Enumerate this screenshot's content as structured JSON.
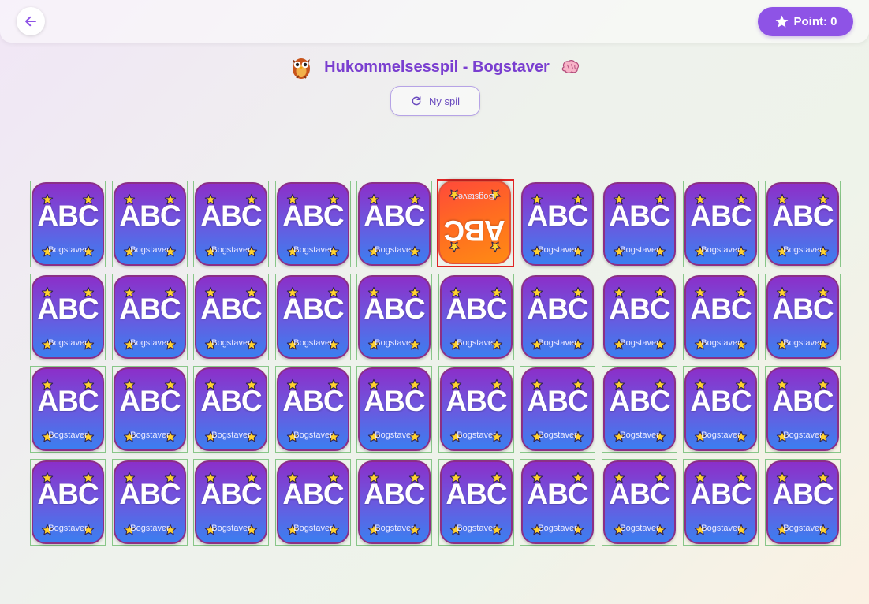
{
  "header": {
    "back_icon": "arrow-left-icon",
    "points_icon": "star-icon",
    "points_label": "Point: 0",
    "accent_color": "#8e53e6"
  },
  "game": {
    "title": "Hukommelsesspil - Bogstaver",
    "title_left_icon": "owl-icon",
    "title_right_icon": "brain-icon",
    "new_game_label": "Ny spil",
    "new_game_icon": "refresh-icon"
  },
  "board": {
    "card_text": "ABC",
    "card_label": "Bogstaver",
    "card_icon": "star-icon",
    "rows": 4,
    "columns": 10,
    "selected_index": 5,
    "colors": {
      "card_back_top": "#8b2fc9",
      "card_back_bottom": "#3b7ff0",
      "card_flipped": "#ff6a22",
      "slot_border": "#88c688",
      "selected_border": "#e02424"
    }
  }
}
